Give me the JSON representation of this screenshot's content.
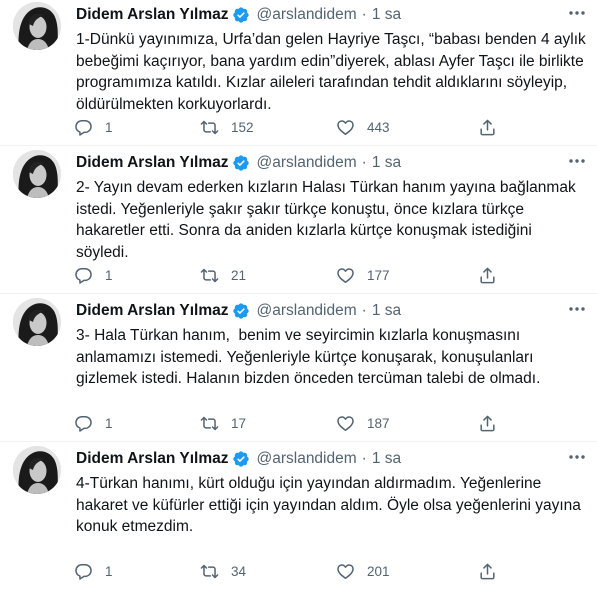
{
  "author": {
    "name": "Didem Arslan Yılmaz",
    "handle": "@arslandidem",
    "separator": "·",
    "time": "1 sa"
  },
  "icons": {
    "verified": "verified-badge-icon",
    "more": "more-options-icon",
    "reply": "reply-icon",
    "retweet": "retweet-icon",
    "like": "like-icon",
    "share": "share-icon"
  },
  "colors": {
    "verified": "#1d9bf0",
    "text": "#0f1419",
    "muted": "#536471"
  },
  "tweets": [
    {
      "text": "1-Dünkü yayınımıza, Urfa’dan gelen Hayriye Taşcı, “babası benden 4 aylık bebeğimi kaçırıyor, bana yardım edin”diyerek, ablası Ayfer Taşcı ile birlikte programımıza katıldı. Kızlar aileleri tarafından tehdit aldıklarını söyleyip, öldürülmekten korkuyorlardı.",
      "replies": "1",
      "retweets": "152",
      "likes": "443"
    },
    {
      "text": "2- Yayın devam ederken kızların Halası Türkan hanım yayına bağlanmak istedi. Yeğenleriyle şakır şakır türkçe konuştu, önce kızlara türkçe hakaretler etti. Sonra da aniden kızlarla kürtçe konuşmak istediğini söyledi.",
      "replies": "1",
      "retweets": "21",
      "likes": "177"
    },
    {
      "text": "3- Hala Türkan hanım,  benim ve seyircimin kızlarla konuşmasını anlamamızı istemedi. Yeğenleriyle kürtçe konuşarak, konuşulanları gizlemek istedi. Halanın bizden önceden tercüman talebi de olmadı.",
      "replies": "1",
      "retweets": "17",
      "likes": "187"
    },
    {
      "text": "4-Türkan hanımı, kürt olduğu için yayından aldırmadım. Yeğenlerine hakaret ve küfürler ettiği için yayından aldım. Öyle olsa yeğenlerini yayına konuk etmezdim.",
      "replies": "1",
      "retweets": "34",
      "likes": "201"
    }
  ]
}
